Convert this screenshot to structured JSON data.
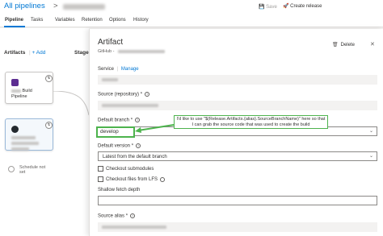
{
  "header": {
    "breadcrumb": "All pipelines",
    "breadcrumb_sep": ">",
    "save_label": "Save",
    "create_release_label": "Create release",
    "save_icon": "save-icon",
    "rocket_icon": "rocket-icon"
  },
  "tabs": [
    {
      "label": "Pipeline",
      "active": true
    },
    {
      "label": "Tasks",
      "active": false
    },
    {
      "label": "Variables",
      "active": false
    },
    {
      "label": "Retention",
      "active": false
    },
    {
      "label": "Options",
      "active": false
    },
    {
      "label": "History",
      "active": false
    }
  ],
  "canvas": {
    "artifacts_title": "Artifacts",
    "add_label": "Add",
    "add_separator": "|",
    "stages_title": "Stages",
    "cards": [
      {
        "line1": "Build",
        "line2": "Pipeline",
        "icon": "build-icon"
      },
      {
        "icon": "github-icon"
      }
    ],
    "schedule_text": "Schedule not set",
    "schedule_icon": "clock-icon"
  },
  "panel": {
    "title": "Artifact",
    "subtitle": "GitHub",
    "subtitle_sep": "-",
    "delete_label": "Delete",
    "service_label": "Service",
    "service_sep": "|",
    "manage_label": "Manage",
    "source_label": "Source (repository)",
    "required_mark": "*",
    "default_branch_label": "Default branch",
    "default_branch_value": "develop",
    "callout_text": "I'd like to use \"$(Release.Artifacts.{alias}.SourceBranchName)\" here so that I can grab the source code that was used to create the build",
    "default_version_label": "Default version",
    "default_version_value": "Latest from the default branch",
    "checkout_submodules_label": "Checkout submodules",
    "checkout_lfs_label": "Checkout files from LFS",
    "shallow_fetch_label": "Shallow fetch depth",
    "source_alias_label": "Source alias"
  },
  "colors": {
    "accent": "#0078d4",
    "callout_border": "#4db34d"
  }
}
